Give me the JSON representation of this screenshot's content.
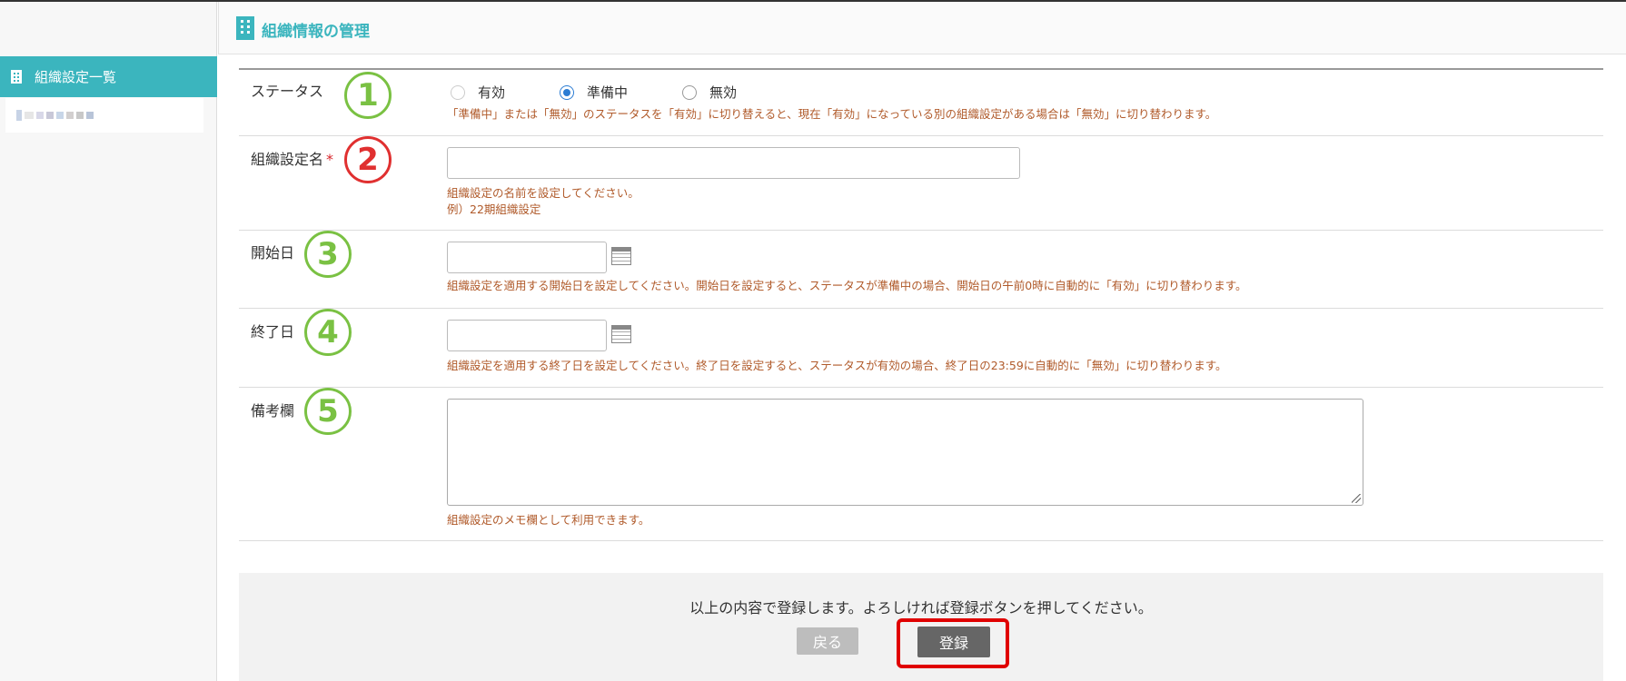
{
  "header": {
    "title": "組織情報の管理"
  },
  "sidebar": {
    "active_item": "組織設定一覧"
  },
  "form": {
    "status": {
      "label": "ステータス",
      "badge": "1",
      "options": [
        "有効",
        "準備中",
        "無効"
      ],
      "selected": "準備中",
      "help": "「準備中」または「無効」のステータスを「有効」に切り替えると、現在「有効」になっている別の組織設定がある場合は「無効」に切り替わります。"
    },
    "name": {
      "label": "組織設定名",
      "required_mark": "*",
      "badge": "2",
      "value": "",
      "help1": "組織設定の名前を設定してください。",
      "help2": "例）22期組織設定"
    },
    "start_date": {
      "label": "開始日",
      "badge": "3",
      "value": "",
      "help": "組織設定を適用する開始日を設定してください。開始日を設定すると、ステータスが準備中の場合、開始日の午前0時に自動的に「有効」に切り替わります。"
    },
    "end_date": {
      "label": "終了日",
      "badge": "4",
      "value": "",
      "help": "組織設定を適用する終了日を設定してください。終了日を設定すると、ステータスが有効の場合、終了日の23:59に自動的に「無効」に切り替わります。"
    },
    "memo": {
      "label": "備考欄",
      "badge": "5",
      "value": "",
      "help": "組織設定のメモ欄として利用できます。"
    }
  },
  "footer": {
    "message": "以上の内容で登録します。よろしければ登録ボタンを押してください。",
    "back_label": "戻る",
    "register_label": "登録"
  },
  "colors": {
    "accent": "#3bb5be",
    "help_text": "#b05a2a",
    "badge_green": "#7ac143",
    "badge_red": "#e03030"
  }
}
